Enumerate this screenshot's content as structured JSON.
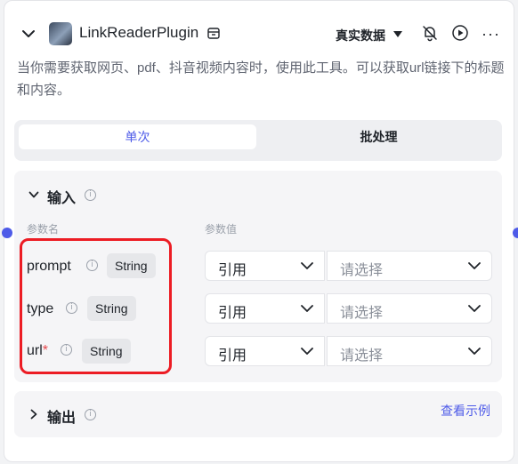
{
  "header": {
    "plugin_name": "LinkReaderPlugin",
    "mode_label": "真实数据",
    "description": "当你需要获取网页、pdf、抖音视频内容时，使用此工具。可以获取url链接下的标题和内容。"
  },
  "tabs": [
    {
      "label": "单次",
      "active": true
    },
    {
      "label": "批处理",
      "active": false
    }
  ],
  "input_section": {
    "title": "输入",
    "col_name": "参数名",
    "col_value": "参数值",
    "params": [
      {
        "name": "prompt",
        "required": false,
        "type": "String",
        "ref": "引用",
        "placeholder": "请选择"
      },
      {
        "name": "type",
        "required": false,
        "type": "String",
        "ref": "引用",
        "placeholder": "请选择"
      },
      {
        "name": "url",
        "required": true,
        "type": "String",
        "ref": "引用",
        "placeholder": "请选择"
      }
    ]
  },
  "output_section": {
    "title": "输出",
    "example_link": "查看示例"
  },
  "icons": {
    "info_glyph": "i",
    "required_mark": "*",
    "more_glyph": "···"
  },
  "colors": {
    "accent": "#4e5be8",
    "highlight_box": "#ec1c24",
    "required": "#e5484d"
  }
}
